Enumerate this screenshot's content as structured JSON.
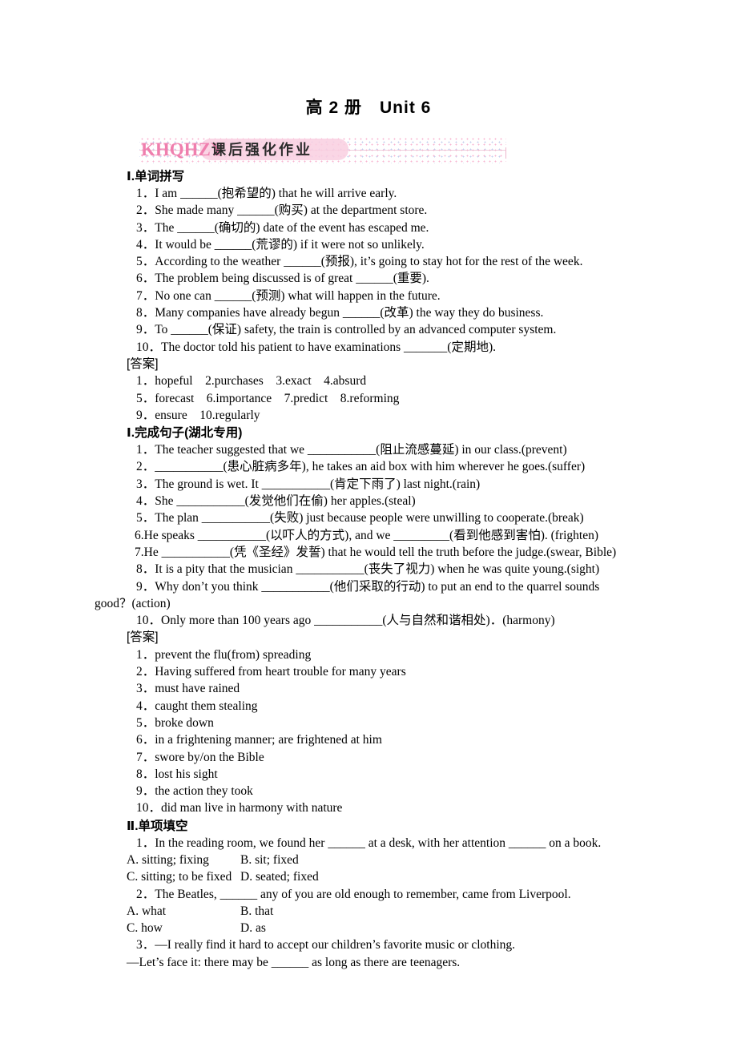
{
  "title": "高 2 册　Unit 6",
  "banner": {
    "logo_text": "KHQHZY",
    "label": "课后强化作业"
  },
  "sections": [
    {
      "id": "section-1",
      "numeral": "Ⅰ",
      "heading": "Ⅰ.单词拼写",
      "questions": [
        "1．I am ______(抱希望的) that he will arrive early.",
        "2．She made many ______(购买) at the department store.",
        "3．The ______(确切的) date of the event has escaped me.",
        "4．It would be ______(荒谬的) if it were not so unlikely.",
        "5．According to the weather ______(预报), it’s going to stay hot for the rest of the week.",
        "6．The problem being discussed is of great ______(重要).",
        "7．No one can ______(预测) what will happen in the future.",
        "8．Many companies have already begun ______(改革) the way they do business.",
        "9．To ______(保证) safety, the train is controlled by an advanced computer system.",
        "10．The doctor told his patient to have examinations _______(定期地)."
      ],
      "answer_label": "[答案]",
      "answers": [
        "1．hopeful　2.purchases　3.exact　4.absurd",
        "5．forecast　6.importance　7.predict　8.reforming",
        "9．ensure　10.regularly"
      ]
    },
    {
      "id": "section-2",
      "numeral": "Ⅰ",
      "heading": "Ⅰ.完成句子(湖北专用)",
      "questions": [
        "1．The teacher suggested that we ___________(阻止流感蔓延) in our class.(prevent)",
        "2．___________(患心脏病多年), he takes an aid box with him wherever he goes.(suffer)",
        "3．The ground is wet. It ___________(肯定下雨了) last night.(rain)",
        "4．She ___________(发觉他们在偷) her apples.(steal)",
        "5．The plan ___________(失败) just because people were unwilling to cooperate.(break)",
        "6.He speaks ___________(以吓人的方式), and we _________(看到他感到害怕). (frighten)",
        "7.He ___________(凭《圣经》发誓) that he would tell the truth before the judge.(swear, Bible)",
        "8．It is a pity that the musician ___________(丧失了视力) when he was quite young.(sight)",
        "9．Why don’t you think ___________(他们采取的行动) to put an end to the quarrel sounds good？(action)",
        "10．Only more than 100 years ago ___________(人与自然和谐相处)．(harmony)"
      ],
      "answer_label": "[答案]",
      "answers": [
        "1．prevent the flu(from) spreading",
        "2．Having suffered from heart trouble for many years",
        "3．must have rained",
        "4．caught them stealing",
        "5．broke down",
        "6．in a frightening manner; are frightened at him",
        "7．swore by/on the Bible",
        "8．lost his sight",
        "9．the action they took",
        "10．did man live in harmony with nature"
      ]
    },
    {
      "id": "section-3",
      "numeral": "Ⅱ",
      "heading": "Ⅱ.单项填空",
      "items": [
        {
          "stem": "1．In the reading room, we found her ______ at a desk, with her attention ______ on a book.",
          "options": [
            [
              "A. sitting; fixing",
              "B. sit; fixed"
            ],
            [
              "C. sitting; to be fixed",
              "D. seated; fixed"
            ]
          ]
        },
        {
          "stem": "2．The Beatles, ______ any of you are old enough to remember, came from Liverpool.",
          "options": [
            [
              "A. what",
              "B. that"
            ],
            [
              "C. how",
              "D. as"
            ]
          ]
        },
        {
          "stem": "3．—I really find it hard to accept our children’s favorite music or clothing.",
          "stem2": "—Let’s face it: there may be ______ as long as there are teenagers.",
          "options": []
        }
      ]
    }
  ],
  "q9_wrap": "good？(action)",
  "colors": {
    "banner_pink": "#ef7fae",
    "banner_band": "#f9cfe0",
    "text": "#000000"
  }
}
